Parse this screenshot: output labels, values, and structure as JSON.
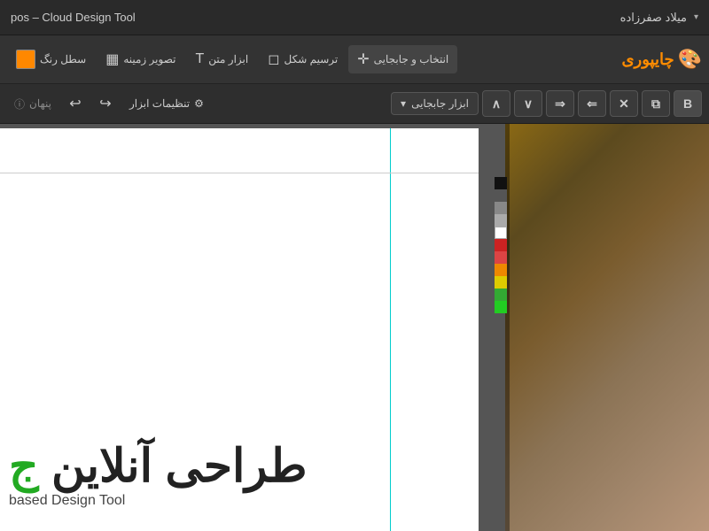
{
  "titlebar": {
    "title": "pos – Cloud Design Tool",
    "user": "میلاد صفرزاده",
    "dropdown_arrow": "▾"
  },
  "main_toolbar": {
    "logo_text": "چایپوری",
    "tools": [
      {
        "id": "select",
        "label": "انتخاب و جابجایی",
        "icon": "✛"
      },
      {
        "id": "draw_shape",
        "label": "ترسیم شکل",
        "icon": "◻"
      },
      {
        "id": "text",
        "label": "ابزار متن",
        "icon": "T"
      },
      {
        "id": "background",
        "label": "تصویر زمینه",
        "icon": "🖼"
      },
      {
        "id": "color_bucket",
        "label": "سطل رنگ",
        "icon": "🪣"
      }
    ],
    "color_swatch": "#ff8800"
  },
  "secondary_toolbar": {
    "bold_label": "B",
    "copy_label": "⧉",
    "delete_label": "✕",
    "arr_left": "⇐",
    "arr_right": "⇒",
    "arr_down": "∨",
    "arr_up": "∧",
    "tool_label": "ابزار جابجایی",
    "undo_label": "↩",
    "redo_label": "↪",
    "settings_label": "تنظیمات ابزار",
    "settings_icon": "⚙",
    "hidden_label": "پنهان",
    "hidden_icon": "ⓘ"
  },
  "canvas": {
    "persian_title": "طراحی آنلاین ج",
    "subtitle": "based Design Tool",
    "guide_color": "#00CCCC"
  },
  "palette": {
    "colors": [
      "#111111",
      "#555555",
      "#888888",
      "#aaaaaa",
      "#ffffff",
      "#cc2222",
      "#dd4444",
      "#ee8800",
      "#ddcc00",
      "#33aa33",
      "#22cc22"
    ]
  }
}
